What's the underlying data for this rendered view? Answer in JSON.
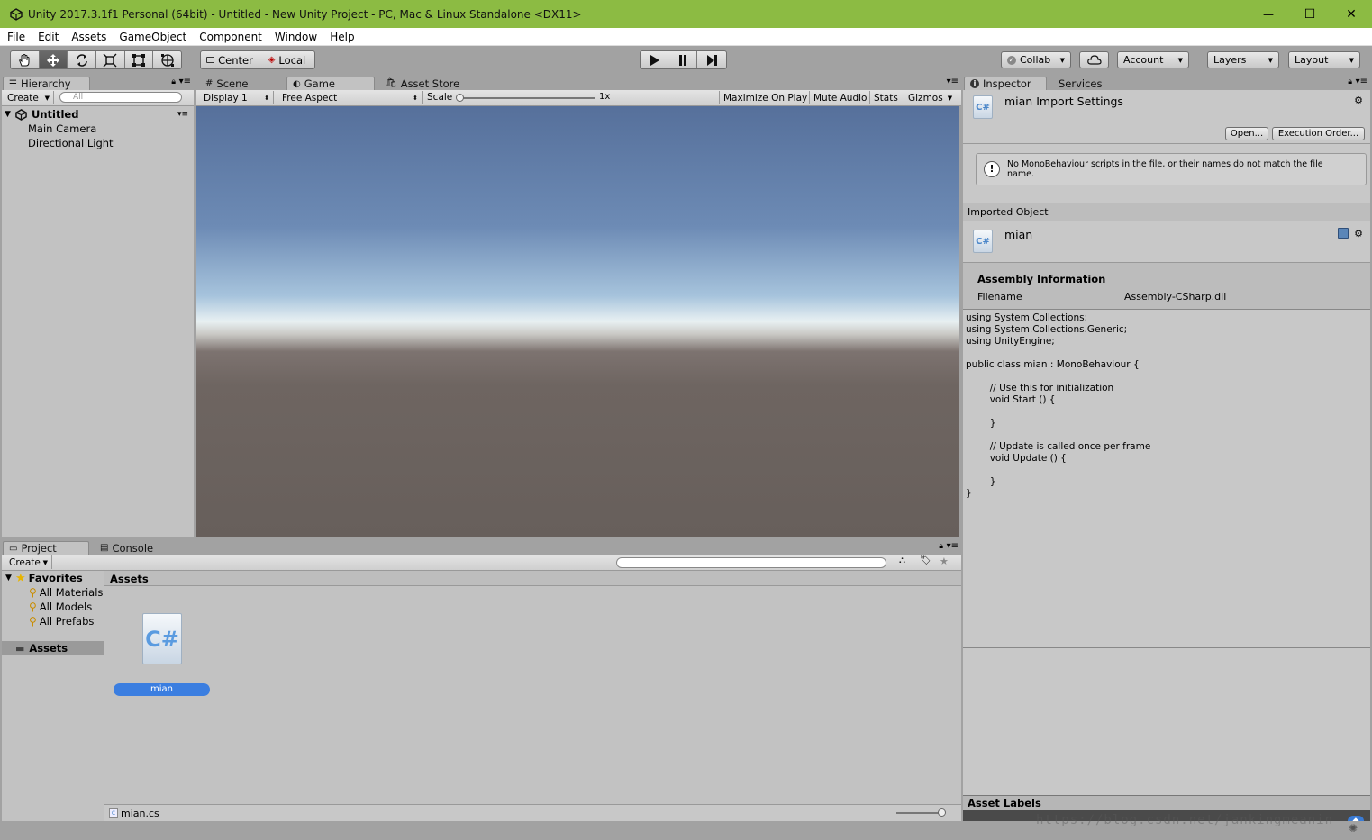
{
  "window": {
    "title": "Unity 2017.3.1f1 Personal (64bit) - Untitled - New Unity Project - PC, Mac & Linux Standalone <DX11>",
    "controls": {
      "minimize": "—",
      "maximize": "☐",
      "close": "✕"
    }
  },
  "menu": {
    "items": [
      "File",
      "Edit",
      "Assets",
      "GameObject",
      "Component",
      "Window",
      "Help"
    ]
  },
  "toolbar": {
    "transform_tools": [
      "hand-tool-icon",
      "move-tool-icon",
      "rotate-tool-icon",
      "scale-tool-icon",
      "rect-tool-icon",
      "transform-tool-icon"
    ],
    "pivot": "Center",
    "pivot_rotation": "Local",
    "collab": "Collab",
    "account": "Account",
    "layers": "Layers",
    "layout": "Layout"
  },
  "hierarchy": {
    "tab": "Hierarchy",
    "create": "Create",
    "search_placeholder": "All",
    "scene": "Untitled",
    "items": [
      "Main Camera",
      "Directional Light"
    ]
  },
  "center": {
    "tabs": [
      "Scene",
      "Game",
      "Asset Store"
    ],
    "display": "Display 1",
    "aspect": "Free Aspect",
    "scale_label": "Scale",
    "scale_value": "1x",
    "scale_slider": 0,
    "maximize": "Maximize On Play",
    "mute": "Mute Audio",
    "stats": "Stats",
    "gizmos": "Gizmos"
  },
  "project": {
    "tabs": [
      "Project",
      "Console"
    ],
    "create": "Create",
    "favorites": "Favorites",
    "favorite_items": [
      "All Materials",
      "All Models",
      "All Prefabs"
    ],
    "assets_root": "Assets",
    "breadcrumb": "Assets",
    "asset_name": "mian",
    "status_file": "mian.cs"
  },
  "inspector": {
    "tabs": [
      "Inspector",
      "Services"
    ],
    "header_title": "mian Import Settings",
    "open_btn": "Open...",
    "exec_btn": "Execution Order...",
    "warning": "No MonoBehaviour scripts in the file, or their names do not match the file name.",
    "imported_label": "Imported Object",
    "object_name": "mian",
    "assembly_title": "Assembly Information",
    "filename_label": "Filename",
    "filename_value": "Assembly-CSharp.dll",
    "code": "using System.Collections;\nusing System.Collections.Generic;\nusing UnityEngine;\n\npublic class mian : MonoBehaviour {\n\n\t// Use this for initialization\n\tvoid Start () {\n\t\t\n\t}\n\t\n\t// Update is called once per frame\n\tvoid Update () {\n\t\t\n\t}\n}",
    "asset_labels": "Asset Labels"
  },
  "watermark": "https://blog.csdn.net/jankingmeanin"
}
